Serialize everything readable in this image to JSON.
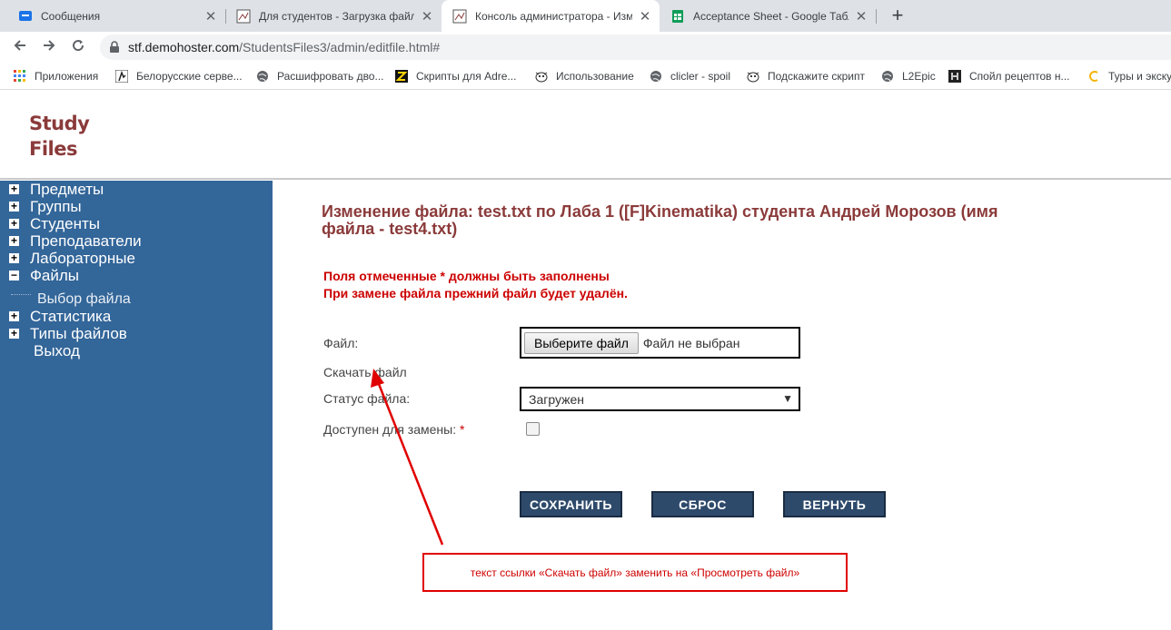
{
  "tabs": [
    {
      "title": "Сообщения",
      "icon": "chat-icon",
      "color": "#1a73e8"
    },
    {
      "title": "Для студентов - Загрузка файло",
      "icon": "doc-icon"
    },
    {
      "title": "Консоль администратора - Изм",
      "icon": "doc-icon",
      "active": true
    },
    {
      "title": "Acceptance Sheet - Google Табл",
      "icon": "sheets-icon",
      "color": "#0f9d58"
    }
  ],
  "toolbar": {
    "url_host": "stf.demohoster.com",
    "url_path": "/StudentsFiles3/admin/editfile.html#"
  },
  "bookmarks": [
    {
      "label": "Приложения",
      "icon": "apps-grid-icon"
    },
    {
      "label": "Белорусские серве...",
      "icon": "cs-icon"
    },
    {
      "label": "Расшифровать дво...",
      "icon": "globe-icon"
    },
    {
      "label": "Скрипты для Adre...",
      "icon": "z-icon"
    },
    {
      "label": "Использование",
      "icon": "dog-icon"
    },
    {
      "label": "clicler - spoil",
      "icon": "globe-icon"
    },
    {
      "label": "Подскажите скрипт",
      "icon": "dog-icon"
    },
    {
      "label": "L2Epic",
      "icon": "globe-icon"
    },
    {
      "label": "Спойл рецептов н...",
      "icon": "castle-icon"
    },
    {
      "label": "Туры и экску",
      "icon": "swirl-icon"
    }
  ],
  "logo": {
    "line1": "Study",
    "line2": "Files"
  },
  "sidebar": {
    "items": [
      {
        "label": "Предметы",
        "state": "plus"
      },
      {
        "label": "Группы",
        "state": "plus"
      },
      {
        "label": "Студенты",
        "state": "plus"
      },
      {
        "label": "Преподаватели",
        "state": "plus"
      },
      {
        "label": "Лабораторные",
        "state": "plus"
      },
      {
        "label": "Файлы",
        "state": "minus"
      },
      {
        "label": "Статистика",
        "state": "plus"
      },
      {
        "label": "Типы файлов",
        "state": "plus"
      },
      {
        "label": "Выход",
        "state": "none"
      }
    ],
    "sub_item": "Выбор файла"
  },
  "main": {
    "heading": "Изменение файла: test.txt по Лаба 1 ([F]Kinematika) студента Андрей Морозов (имя файла - test4.txt)",
    "note1": "Поля отмеченные * должны быть заполнены",
    "note2": "При замене файла прежний файл будет удалён.",
    "file_label": "Файл:",
    "file_button": "Выберите файл",
    "file_status": "Файл не выбран",
    "download_link": "Скачать файл",
    "status_label": "Статус файла:",
    "status_value": "Загружен",
    "replace_label": "Доступен для замены:",
    "required_mark": "*",
    "buttons": {
      "save": "СОХРАНИТЬ",
      "reset": "СБРОС",
      "back": "ВЕРНУТЬ"
    }
  },
  "annotation": {
    "text": "текст ссылки «Скачать файл» заменить на «Просмотреть файл»",
    "color": "#e00000"
  },
  "colors": {
    "sidebar": "#336699",
    "heading": "#8b3a3a",
    "button": "#2e4a6b"
  }
}
